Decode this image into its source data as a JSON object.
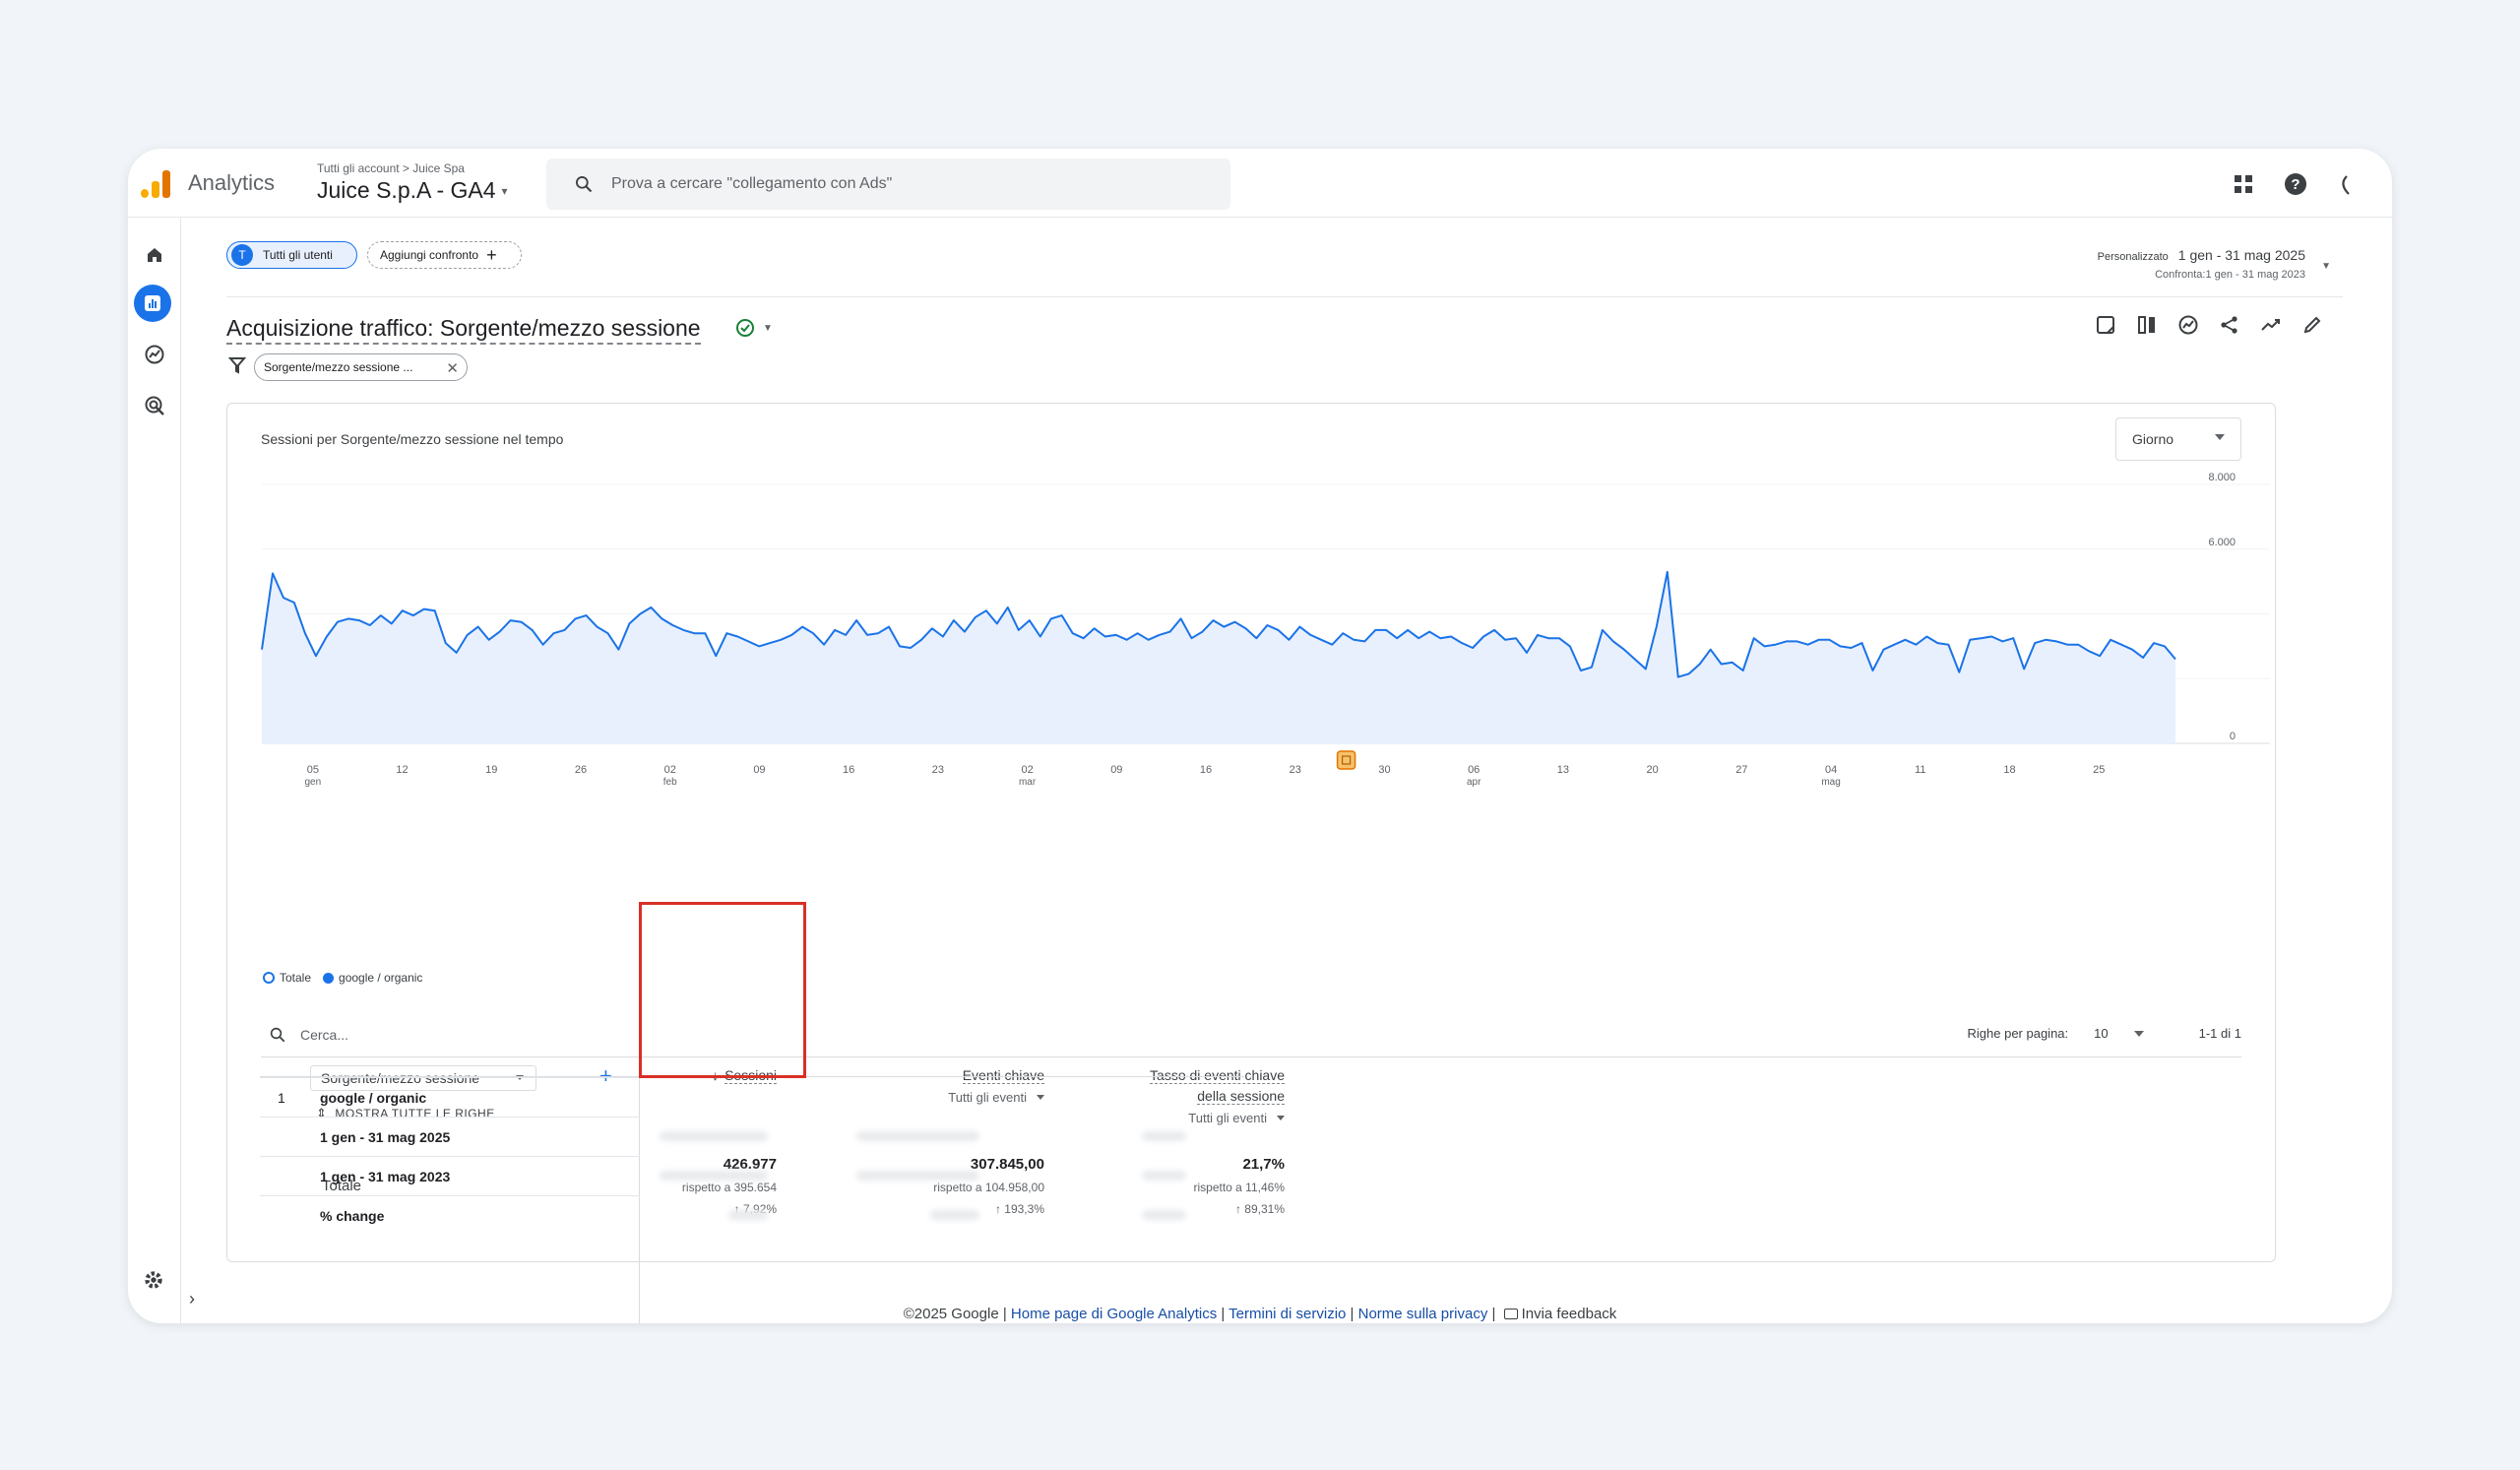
{
  "app": {
    "brand": "Analytics",
    "breadcrumb": "Tutti gli account > Juice Spa",
    "property": "Juice S.p.A - GA4",
    "search_placeholder": "Prova a cercare \"collegamento con Ads\"",
    "top_icons": [
      "apps-grid-icon",
      "help-icon",
      "account-icon"
    ]
  },
  "rail": [
    "home-icon",
    "reports-icon",
    "explore-icon",
    "advertising-icon",
    "settings-icon"
  ],
  "segments": {
    "users_initial": "T",
    "users_label": "Tutti gli utenti",
    "compare_label": "Aggiungi confronto"
  },
  "date_range": {
    "preset": "Personalizzato",
    "range": "1 gen - 31 mag 2025",
    "compare": "Confronta:1 gen - 31 mag 2023"
  },
  "report": {
    "title": "Acquisizione traffico: Sorgente/mezzo sessione",
    "filter_chip": "Sorgente/mezzo sessione ..."
  },
  "chart": {
    "title": "Sessioni per Sorgente/mezzo sessione nel tempo",
    "granularity": "Giorno",
    "legend": [
      "Totale",
      "google / organic"
    ],
    "annotation_marker": "annotation-icon"
  },
  "chart_data": {
    "type": "line",
    "title": "Sessioni per Sorgente/mezzo sessione nel tempo",
    "y_ticks": [
      "8.000",
      "6.000",
      "0"
    ],
    "ylim": [
      0,
      8000
    ],
    "x_ticks": [
      {
        "label": "05",
        "sub": "gen"
      },
      {
        "label": "12",
        "sub": ""
      },
      {
        "label": "19",
        "sub": ""
      },
      {
        "label": "26",
        "sub": ""
      },
      {
        "label": "02",
        "sub": "feb"
      },
      {
        "label": "09",
        "sub": ""
      },
      {
        "label": "16",
        "sub": ""
      },
      {
        "label": "23",
        "sub": ""
      },
      {
        "label": "02",
        "sub": "mar"
      },
      {
        "label": "09",
        "sub": ""
      },
      {
        "label": "16",
        "sub": ""
      },
      {
        "label": "23",
        "sub": ""
      },
      {
        "label": "30",
        "sub": ""
      },
      {
        "label": "06",
        "sub": "apr"
      },
      {
        "label": "13",
        "sub": ""
      },
      {
        "label": "20",
        "sub": ""
      },
      {
        "label": "27",
        "sub": ""
      },
      {
        "label": "04",
        "sub": "mag"
      },
      {
        "label": "11",
        "sub": ""
      },
      {
        "label": "18",
        "sub": ""
      },
      {
        "label": "25",
        "sub": ""
      }
    ],
    "x": [
      "2025-01-01",
      "2025-05-31"
    ],
    "series": [
      {
        "name": "google / organic",
        "values": [
          2900,
          5250,
          4500,
          4350,
          3400,
          2700,
          3300,
          3750,
          3850,
          3800,
          3650,
          3950,
          3700,
          4100,
          3950,
          4150,
          4100,
          3100,
          2800,
          3350,
          3600,
          3200,
          3450,
          3800,
          3750,
          3500,
          3050,
          3400,
          3500,
          3850,
          3950,
          3600,
          3400,
          2900,
          3700,
          4000,
          4200,
          3850,
          3650,
          3500,
          3400,
          3400,
          2700,
          3400,
          3300,
          3150,
          3000,
          3100,
          3200,
          3350,
          3600,
          3400,
          3050,
          3500,
          3350,
          3800,
          3350,
          3400,
          3600,
          3000,
          2950,
          3200,
          3550,
          3300,
          3800,
          3450,
          3900,
          4100,
          3700,
          4200,
          3500,
          3800,
          3300,
          3850,
          3950,
          3400,
          3250,
          3550,
          3300,
          3350,
          3200,
          3400,
          3200,
          3350,
          3450,
          3850,
          3250,
          3450,
          3800,
          3600,
          3750,
          3550,
          3250,
          3650,
          3500,
          3200,
          3600,
          3350,
          3200,
          3050,
          3400,
          3200,
          3150,
          3500,
          3500,
          3250,
          3500,
          3250,
          3450,
          3250,
          3300,
          3100,
          2950,
          3300,
          3500,
          3200,
          3250,
          2800,
          3350,
          3250,
          3250,
          3000,
          2250,
          2350,
          3500,
          3150,
          2900,
          2600,
          2300,
          3600,
          5300,
          2050,
          2150,
          2450,
          2900,
          2450,
          2500,
          2250,
          3250,
          3000,
          3050,
          3150,
          3150,
          3050,
          3200,
          3200,
          3000,
          2950,
          3100,
          2250,
          2900,
          3050,
          3200,
          3050,
          3300,
          3100,
          3050,
          2200,
          3200,
          3250,
          3300,
          3150,
          3250,
          2300,
          3100,
          3200,
          3150,
          3050,
          3050,
          2850,
          2700,
          3200,
          3050,
          2900,
          2650,
          3100,
          3000,
          2600
        ]
      }
    ]
  },
  "table": {
    "search_placeholder": "Cerca...",
    "rows_per_page_label": "Righe per pagina:",
    "rows_per_page": "10",
    "pagination": "1-1 di 1",
    "dimension": "Sorgente/mezzo sessione",
    "show_all": "MOSTRA TUTTE LE RIGHE",
    "columns": [
      {
        "name": "Sessioni",
        "sort": "desc",
        "sub": ""
      },
      {
        "name": "Eventi chiave",
        "sub": "Tutti gli eventi"
      },
      {
        "name": "Tasso di eventi chiave della sessione",
        "name_l1": "Tasso di eventi chiave",
        "name_l2": "della sessione",
        "sub": "Tutti gli eventi"
      }
    ],
    "totals": {
      "label": "Totale",
      "values": [
        {
          "value": "426.977",
          "ref": "rispetto a 395.654",
          "change": "↑ 7,92%"
        },
        {
          "value": "307.845,00",
          "ref": "rispetto a 104.958,00",
          "change": "↑ 193,3%"
        },
        {
          "value": "21,7%",
          "ref": "rispetto a 11,46%",
          "change": "↑ 89,31%"
        }
      ]
    },
    "rows": [
      {
        "index": "1",
        "label": "google / organic"
      },
      {
        "index": "",
        "label": "1 gen - 31 mag 2025"
      },
      {
        "index": "",
        "label": "1 gen - 31 mag 2023"
      },
      {
        "index": "",
        "label": "% change"
      }
    ],
    "highlight_color": "#d93025"
  },
  "footer": {
    "copyright": "©2025 Google |",
    "links": [
      "Home page di Google Analytics",
      "Termini di servizio",
      "Norme sulla privacy"
    ],
    "feedback": "Invia feedback"
  },
  "colors": {
    "accent": "#1a73e8",
    "line": "#1a73e8",
    "area": "#e8f0fe",
    "logo_orange": "#f9ab00",
    "logo_dark": "#e37400"
  }
}
